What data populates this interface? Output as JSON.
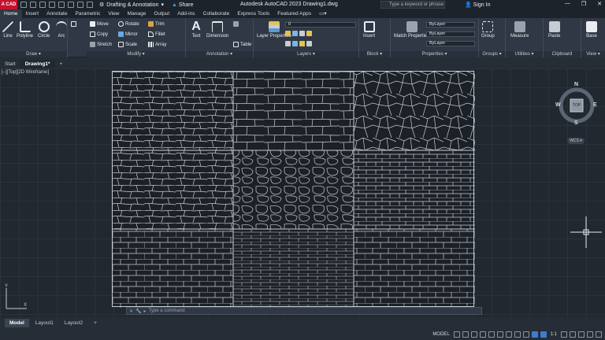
{
  "app": {
    "logo": "A CAD",
    "workspace": "Drafting & Annotation",
    "share_label": "Share",
    "title": "Autodesk AutoCAD 2023    Drawing1.dwg",
    "search_placeholder": "Type a keyword or phrase",
    "signin_label": "Sign In",
    "window_controls": [
      "—",
      "❐",
      "✕"
    ]
  },
  "ribbon_tabs": [
    "Home",
    "Insert",
    "Annotate",
    "Parametric",
    "View",
    "Manage",
    "Output",
    "Add-ins",
    "Collaborate",
    "Express Tools",
    "Featured Apps",
    "▭▾"
  ],
  "active_ribbon_tab": "Home",
  "panels": {
    "draw": {
      "title": "Draw ▾",
      "tools": [
        "Line",
        "Polyline",
        "Circle",
        "Arc"
      ]
    },
    "modify": {
      "title": "Modify ▾",
      "tools": [
        "Move",
        "Rotate",
        "Trim",
        "Copy",
        "Mirror",
        "Fillet",
        "Stretch",
        "Scale",
        "Array"
      ]
    },
    "annotation": {
      "title": "Annotation ▾",
      "tools": [
        "Text",
        "Dimension",
        "Table"
      ]
    },
    "layers": {
      "title": "Layers ▾",
      "tools": [
        "Layer Properties"
      ],
      "current_layer": "0"
    },
    "block": {
      "title": "Block ▾",
      "tools": [
        "Insert"
      ]
    },
    "properties": {
      "title": "Properties ▾",
      "tools": [
        "Match Properties"
      ],
      "values": [
        "ByLayer",
        "ByLayer",
        "ByLayer"
      ]
    },
    "groups": {
      "title": "Groups ▾",
      "tools": [
        "Group"
      ]
    },
    "utilities": {
      "title": "Utilities ▾",
      "tools": [
        "Measure"
      ]
    },
    "clipboard": {
      "title": "Clipboard",
      "tools": [
        "Paste"
      ]
    },
    "view": {
      "title": "View ▾",
      "tools": [
        "Base"
      ]
    }
  },
  "doc_tabs": [
    "Start",
    "Drawing1*",
    "+"
  ],
  "active_doc_tab": "Drawing1*",
  "viewport_label": "[–][Top][2D Wireframe]",
  "viewcube": {
    "north": "N",
    "south": "S",
    "east": "E",
    "west": "W",
    "face": "TOP",
    "wcs": "WCS ▾"
  },
  "command_line": {
    "placeholder": "Type a command"
  },
  "layout_tabs": [
    "Model",
    "Layout1",
    "Layout2",
    "+"
  ],
  "active_layout": "Model",
  "status": {
    "mode": "MODEL",
    "scale": "1:1"
  },
  "colors": {
    "accent": "#3b7ed0",
    "background": "#212830",
    "ribbon": "#2f3844",
    "logo": "#c4122f"
  }
}
